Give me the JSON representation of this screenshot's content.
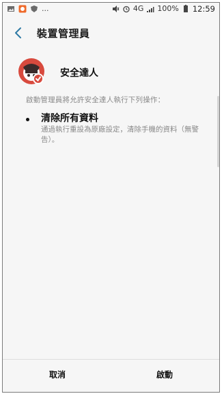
{
  "status_bar": {
    "left_icons": [
      "image-icon",
      "app-notification-icon",
      "shield-icon"
    ],
    "overflow": "...",
    "battery": "100%",
    "time": "12:59",
    "network": "4G"
  },
  "appbar": {
    "title": "裝置管理員",
    "back_icon": "chevron-left-icon"
  },
  "app": {
    "name": "安全達人"
  },
  "description": "啟動管理員將允許安全達人執行下列操作：",
  "policies": [
    {
      "title": "清除所有資料",
      "desc": "通過執行重設為原廠設定，清除手機的資料（無警告）。"
    }
  ],
  "buttons": {
    "cancel": "取消",
    "enable": "啟動"
  },
  "colors": {
    "accent": "#2e7aa5",
    "text_secondary": "#8a8a8a"
  }
}
